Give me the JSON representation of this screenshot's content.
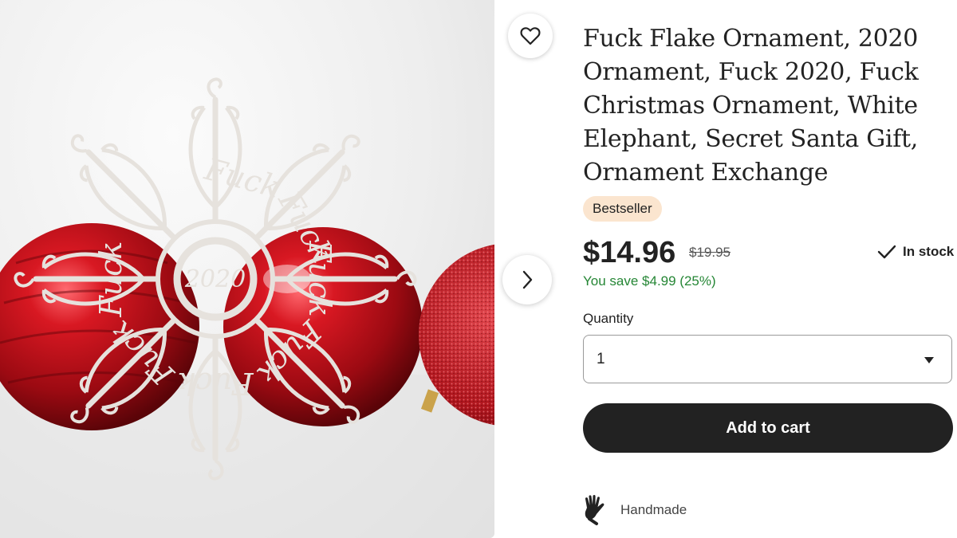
{
  "product": {
    "title": "Fuck Flake Ornament, 2020 Ornament, Fuck 2020, Fuck Christmas Ornament, White Elephant, Secret Santa Gift, Ornament Exchange",
    "badge": "Bestseller",
    "price": "$14.96",
    "original_price": "$19.95",
    "savings": "You save $4.99 (25%)",
    "stock_status": "In stock"
  },
  "image": {
    "center_text": "2020",
    "arm_text": "Fuck"
  },
  "quantity": {
    "label": "Quantity",
    "selected_value": "1"
  },
  "actions": {
    "add_to_cart": "Add to cart"
  },
  "features": {
    "handmade": "Handmade"
  },
  "icons": {
    "favorite": "heart-icon",
    "next": "chevron-right-icon",
    "stock": "checkmark-icon",
    "handmade": "hand-icon",
    "dropdown": "caret-down-icon"
  },
  "colors": {
    "savings_green": "#258635",
    "badge_bg": "#fbe5cf",
    "cart_button_bg": "#222222",
    "ornament_red": "#b8101a"
  }
}
